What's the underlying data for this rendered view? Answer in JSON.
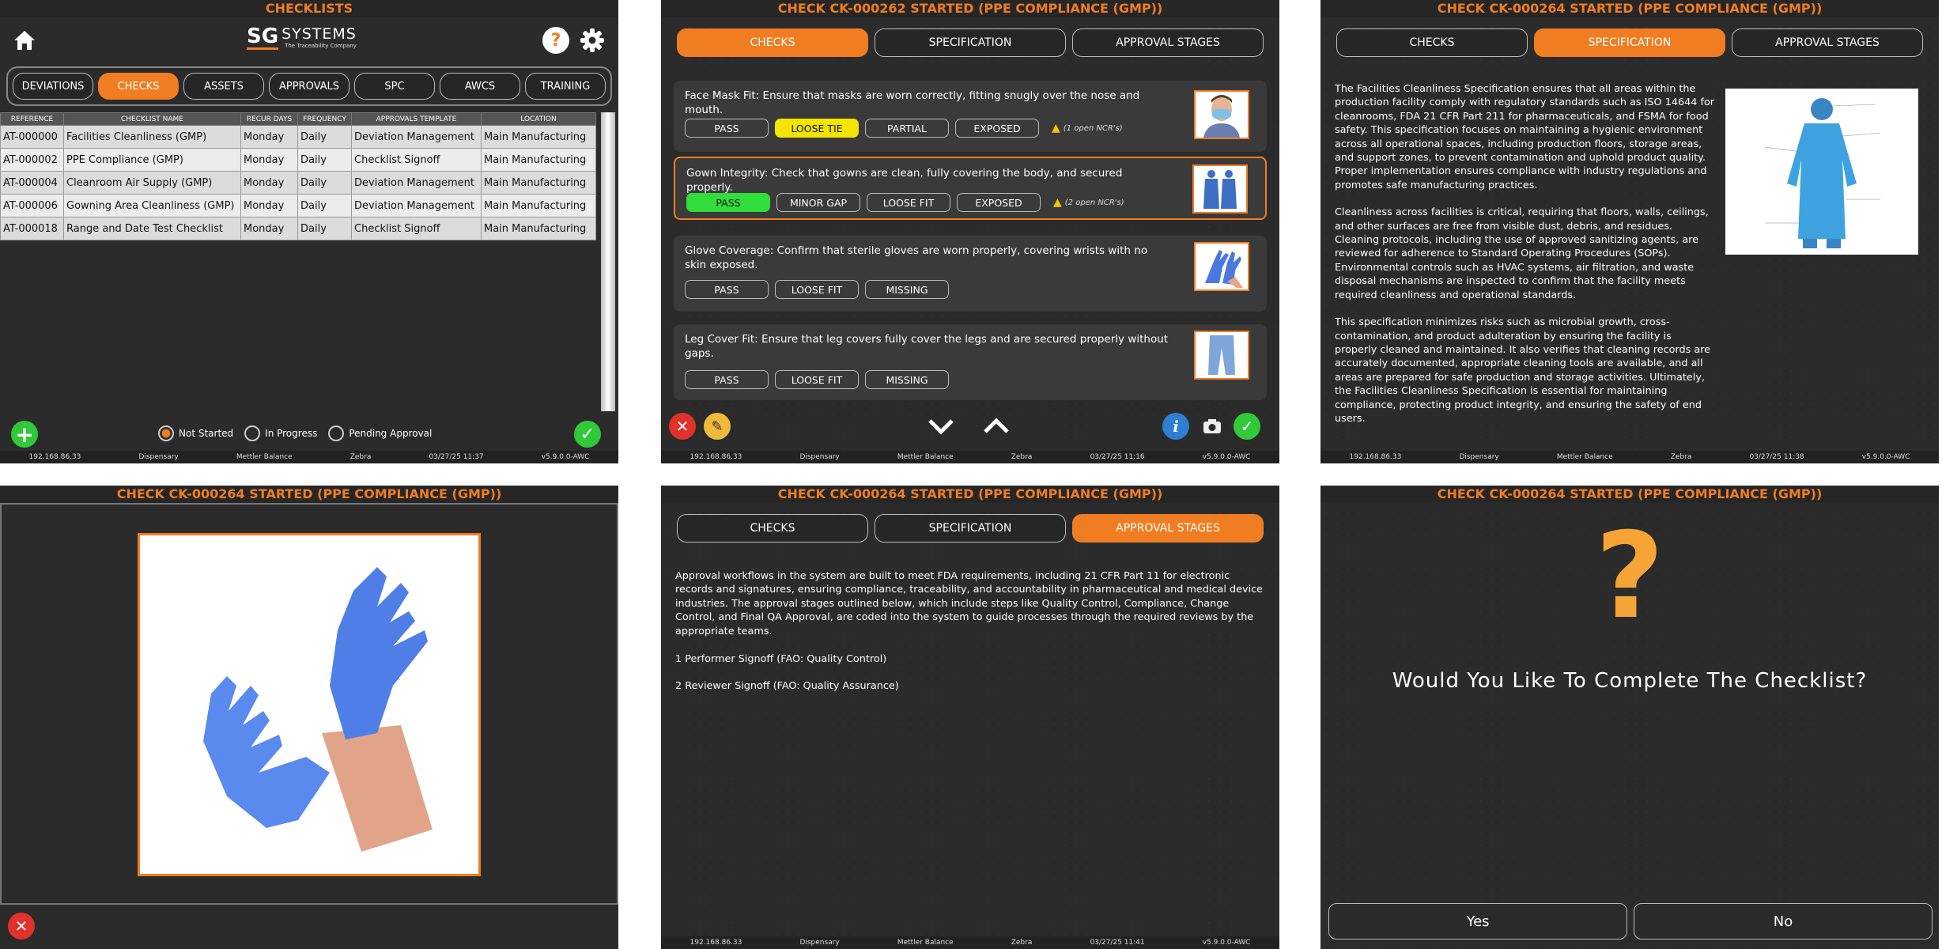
{
  "p1": {
    "title": "CHECKLISTS",
    "logo_main": "SG",
    "logo_systems": "SYSTEMS",
    "logo_sub": "The Traceability Company",
    "nav": [
      "DEVIATIONS",
      "CHECKS",
      "ASSETS",
      "APPROVALS",
      "SPC",
      "AWCS",
      "TRAINING"
    ],
    "cols": [
      "REFERENCE",
      "CHECKLIST NAME",
      "RECUR DAYS",
      "FREQUENCY",
      "APPROVALS TEMPLATE",
      "LOCATION"
    ],
    "rows": [
      [
        "AT-000000",
        "Facilities Cleanliness (GMP)",
        "Monday",
        "Daily",
        "Deviation Management",
        "Main Manufacturing"
      ],
      [
        "AT-000002",
        "PPE Compliance (GMP)",
        "Monday",
        "Daily",
        "Checklist Signoff",
        "Main Manufacturing"
      ],
      [
        "AT-000004",
        "Cleanroom Air Supply (GMP)",
        "Monday",
        "Daily",
        "Deviation Management",
        "Main Manufacturing"
      ],
      [
        "AT-000006",
        "Gowning Area Cleanliness (GMP)",
        "Monday",
        "Daily",
        "Deviation Management",
        "Main Manufacturing"
      ],
      [
        "AT-000018",
        "Range and Date Test Checklist",
        "Monday",
        "Daily",
        "Checklist Signoff",
        "Main Manufacturing"
      ]
    ],
    "radios": [
      "Not Started",
      "In Progress",
      "Pending Approval"
    ],
    "status": [
      "192.168.86.33",
      "Dispensary",
      "Mettler Balance",
      "Zebra",
      "03/27/25 11:37",
      "v5.9.0.0-AWC"
    ]
  },
  "tabs": [
    "CHECKS",
    "SPECIFICATION",
    "APPROVAL STAGES"
  ],
  "p2": {
    "title": "CHECK CK-000262 STARTED (PPE COMPLIANCE (GMP))",
    "checks": [
      {
        "q": "Face Mask Fit: Ensure that masks are worn correctly, fitting snugly over the nose and mouth.",
        "opts": [
          "PASS",
          "LOOSE TIE",
          "PARTIAL",
          "EXPOSED"
        ],
        "ncr": "(1 open NCR's)"
      },
      {
        "q": "Gown Integrity: Check that gowns are clean, fully covering the body, and secured properly.",
        "opts": [
          "PASS",
          "MINOR GAP",
          "LOOSE FIT",
          "EXPOSED"
        ],
        "ncr": "(2 open NCR's)"
      },
      {
        "q": "Glove Coverage: Confirm that sterile gloves are worn properly, covering wrists with no skin exposed.",
        "opts": [
          "PASS",
          "LOOSE FIT",
          "MISSING"
        ]
      },
      {
        "q": "Leg Cover Fit: Ensure that leg covers fully cover the legs and are secured properly without gaps.",
        "opts": [
          "PASS",
          "LOOSE FIT",
          "MISSING"
        ]
      }
    ],
    "status": [
      "192.168.86.33",
      "Dispensary",
      "Mettler Balance",
      "Zebra",
      "03/27/25 11:16",
      "v5.9.0.0-AWC"
    ]
  },
  "p3": {
    "title": "CHECK CK-000264 STARTED (PPE COMPLIANCE (GMP))",
    "para1": "The Facilities Cleanliness Specification ensures that all areas within the production facility comply with regulatory standards such as ISO 14644 for cleanrooms, FDA 21 CFR Part 211 for pharmaceuticals, and FSMA for food safety. This specification focuses on maintaining a hygienic environment across all operational spaces, including production floors, storage areas, and support zones, to prevent contamination and uphold product quality. Proper implementation ensures compliance with industry regulations and promotes safe manufacturing practices.",
    "para2": "Cleanliness across facilities is critical, requiring that floors, walls, ceilings, and other surfaces are free from visible dust, debris, and residues. Cleaning protocols, including the use of approved sanitizing agents, are reviewed for adherence to Standard Operating Procedures (SOPs). Environmental controls such as HVAC systems, air filtration, and waste disposal mechanisms are inspected to confirm that the facility meets required cleanliness and operational standards.",
    "para3": "This specification minimizes risks such as microbial growth, cross-contamination, and product adulteration by ensuring the facility is properly cleaned and maintained. It also verifies that cleaning records are accurately documented, appropriate cleaning tools are available, and all areas are prepared for safe production and storage activities. Ultimately, the Facilities Cleanliness Specification is essential for maintaining compliance, protecting product integrity, and ensuring the safety of end users.",
    "status": [
      "192.168.86.33",
      "Dispensary",
      "Mettler Balance",
      "Zebra",
      "03/27/25 11:38",
      "v5.9.0.0-AWC"
    ]
  },
  "p4": {
    "title": "CHECK CK-000264 STARTED (PPE COMPLIANCE (GMP))"
  },
  "p5": {
    "title": "CHECK CK-000264 STARTED (PPE COMPLIANCE (GMP))",
    "intro": "Approval workflows in the system are built to meet FDA requirements, including 21 CFR Part 11 for electronic records and signatures, ensuring compliance, traceability, and accountability in pharmaceutical and medical device industries. The approval stages outlined below, which include steps like Quality Control, Compliance, Change Control, and Final QA Approval, are coded into the system to guide processes through the required reviews by the appropriate teams.",
    "stage1": "1 Performer Signoff (FAO: Quality Control)",
    "stage2": "2 Reviewer Signoff (FAO: Quality Assurance)",
    "status": [
      "192.168.86.33",
      "Dispensary",
      "Mettler Balance",
      "Zebra",
      "03/27/25 11:41",
      "v5.9.0.0-AWC"
    ]
  },
  "p6": {
    "title": "CHECK CK-000264 STARTED (PPE COMPLIANCE (GMP))",
    "mark": "?",
    "question": "Would You Like To Complete The Checklist?",
    "yes": "Yes",
    "no": "No"
  },
  "colors": {
    "accent": "#f07d22",
    "pass": "#30dd3a",
    "warn": "#f4e400",
    "cancel": "#e0312a",
    "info": "#2e7fd1"
  }
}
